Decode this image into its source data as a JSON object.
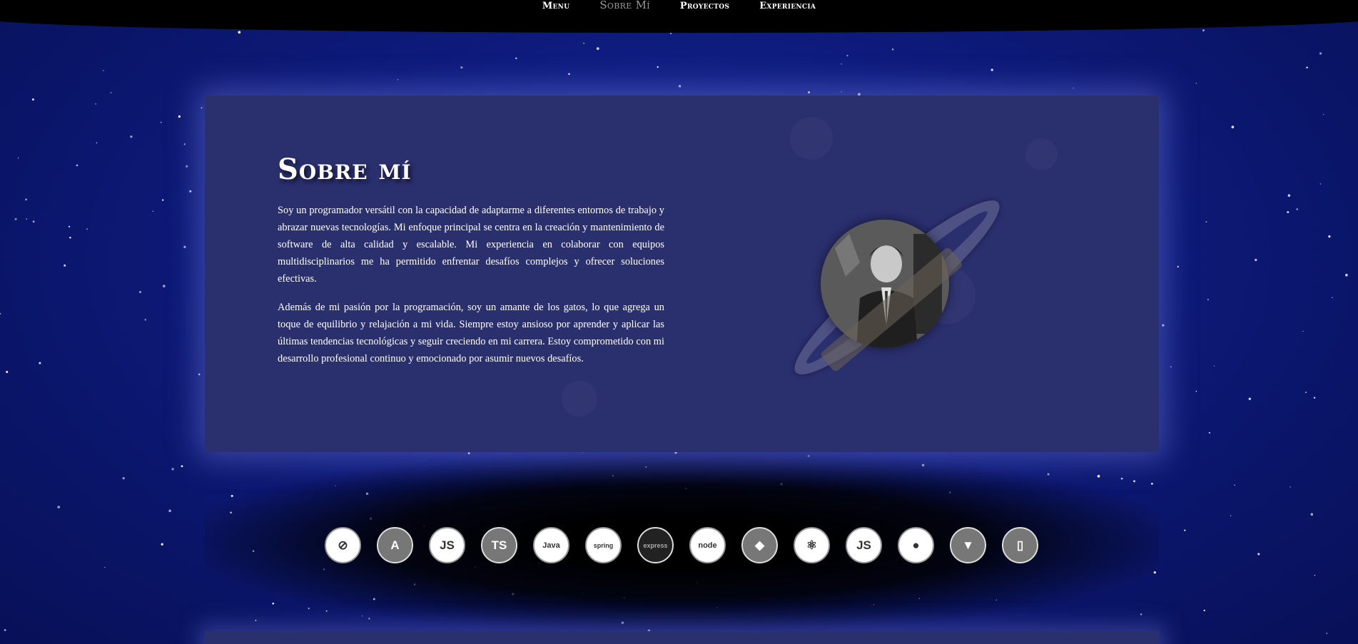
{
  "nav": {
    "items": [
      {
        "label": "Menu",
        "active": false
      },
      {
        "label": "Sobre Mí",
        "active": true
      },
      {
        "label": "Proyectos",
        "active": false
      },
      {
        "label": "Experiencia",
        "active": false
      }
    ]
  },
  "about": {
    "title": "Sobre mí",
    "paragraph1": "Soy un programador versátil con la capacidad de adaptarme a diferentes entornos de trabajo y abrazar nuevas tecnologías. Mi enfoque principal se centra en la creación y mantenimiento de software de alta calidad y escalable. Mi experiencia en colaborar con equipos multidisciplinarios me ha permitido enfrentar desafíos complejos y ofrecer soluciones efectivas.",
    "paragraph2": "Además de mi pasión por la programación, soy un amante de los gatos, lo que agrega un toque de equilibrio y relajación a mi vida. Siempre estoy ansioso por aprender y aplicar las últimas tendencias tecnológicas y seguir creciendo en mi carrera. Estoy comprometido con mi desarrollo profesional continuo y emocionado por asumir nuevos desafíos."
  },
  "tech_icons": [
    {
      "name": "no-entry-icon",
      "glyph": "⊘",
      "style": "light"
    },
    {
      "name": "angular-icon",
      "glyph": "A",
      "style": "grey"
    },
    {
      "name": "javascript-icon",
      "glyph": "JS",
      "style": "light"
    },
    {
      "name": "typescript-icon",
      "glyph": "TS",
      "style": "grey"
    },
    {
      "name": "java-icon",
      "glyph": "Java",
      "style": "light"
    },
    {
      "name": "spring-icon",
      "glyph": "spring",
      "style": "light"
    },
    {
      "name": "express-icon",
      "glyph": "express",
      "style": "black"
    },
    {
      "name": "nodejs-icon",
      "glyph": "node",
      "style": "light"
    },
    {
      "name": "git-icon",
      "glyph": "◆",
      "style": "grey"
    },
    {
      "name": "react-icon",
      "glyph": "⚛",
      "style": "light"
    },
    {
      "name": "javascript-alt-icon",
      "glyph": "JS",
      "style": "light"
    },
    {
      "name": "github-icon",
      "glyph": "●",
      "style": "light"
    },
    {
      "name": "gitlab-icon",
      "glyph": "▼",
      "style": "grey"
    },
    {
      "name": "office-icon",
      "glyph": "▯",
      "style": "grey"
    }
  ],
  "colors": {
    "background": "#0d1a7a",
    "panel": "#2a2f6e",
    "nav": "#000000",
    "nav_active": "#9a9a9a"
  }
}
